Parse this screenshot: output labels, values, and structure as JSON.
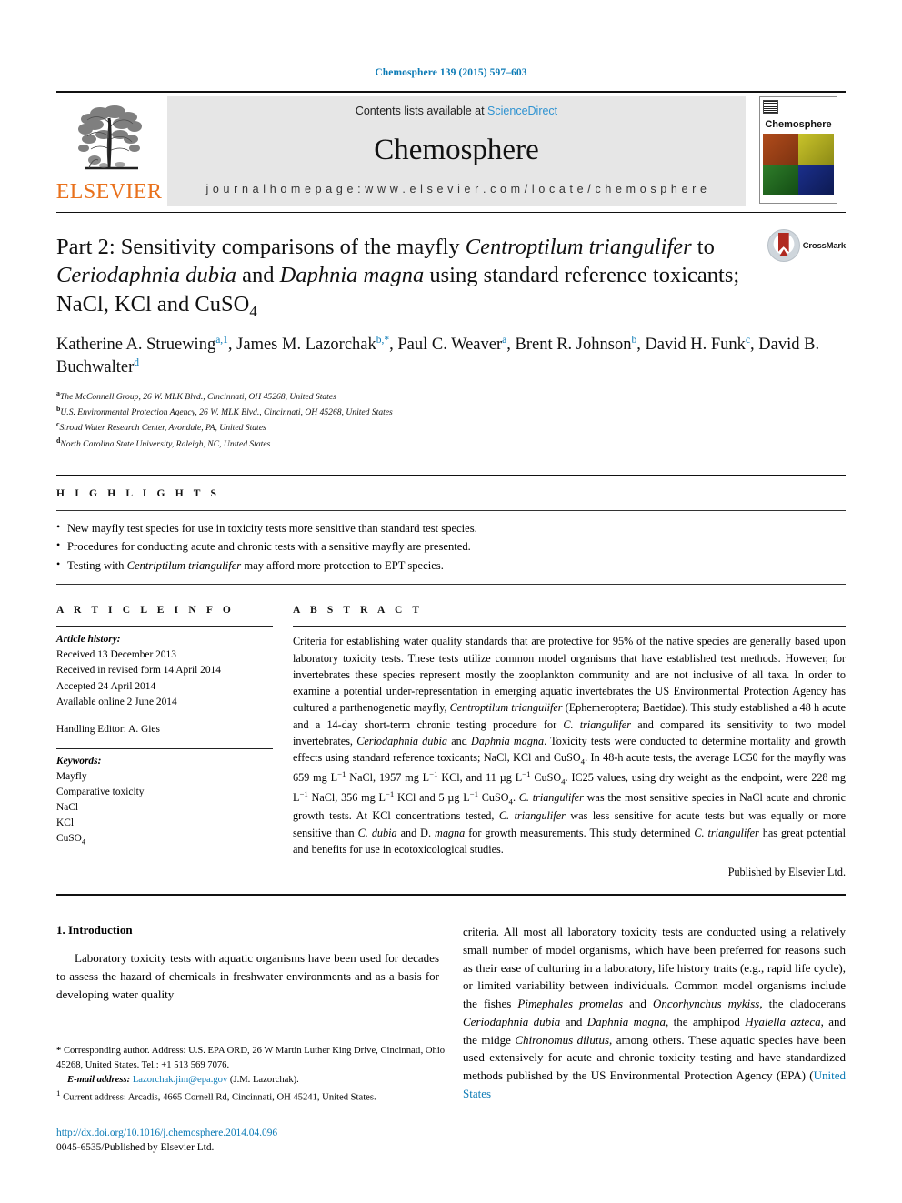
{
  "running_head": "Chemosphere 139 (2015) 597–603",
  "masthead": {
    "publisher_name": "ELSEVIER",
    "contents_text": "Contents lists available at ",
    "sciencedirect_label": "ScienceDirect",
    "journal_title": "Chemosphere",
    "homepage_text": "j o u r n a l   h o m e p a g e :   w w w . e l s e v i e r . c o m / l o c a t e / c h e m o s p h e r e",
    "cover_title": "Chemosphere",
    "accent_link_color": "#2f93d1",
    "elsevier_orange": "#E9711C"
  },
  "title": {
    "line1_a": "Part 2: Sensitivity comparisons of the mayfly ",
    "line1_i": "Centroptilum triangulifer",
    "line2_a": "to ",
    "line2_i1": "Ceriodaphnia dubia",
    "line2_b": " and ",
    "line2_i2": "Daphnia magna",
    "line2_c": " using standard reference",
    "line3_a": "toxicants; NaCl, KCl and CuSO",
    "line3_sub": "4",
    "crossmark_label": "CrossMark"
  },
  "authors": {
    "list": "Katherine A. Struewing a,1, James M. Lazorchak b,*, Paul C. Weaver a, Brent R. Johnson b, David H. Funk c, David B. Buchwalter d",
    "names": [
      {
        "name": "Katherine A. Struewing",
        "sup": "a,1"
      },
      {
        "name": "James M. Lazorchak",
        "sup": "b,*"
      },
      {
        "name": "Paul C. Weaver",
        "sup": "a"
      },
      {
        "name": "Brent R. Johnson",
        "sup": "b"
      },
      {
        "name": "David H. Funk",
        "sup": "c"
      },
      {
        "name": "David B. Buchwalter",
        "sup": "d"
      }
    ],
    "affiliations": [
      {
        "mark": "a",
        "text": "The McConnell Group, 26 W. MLK Blvd., Cincinnati, OH 45268, United States"
      },
      {
        "mark": "b",
        "text": "U.S. Environmental Protection Agency, 26 W. MLK Blvd., Cincinnati, OH 45268, United States"
      },
      {
        "mark": "c",
        "text": "Stroud Water Research Center, Avondale, PA, United States"
      },
      {
        "mark": "d",
        "text": "North Carolina State University, Raleigh, NC, United States"
      }
    ]
  },
  "highlights": {
    "heading": "H I G H L I G H T S",
    "items": [
      {
        "pre": "New mayfly test species for use in toxicity tests more sensitive than standard test species.",
        "italic": "",
        "post": ""
      },
      {
        "pre": "Procedures for conducting acute and chronic tests with a sensitive mayfly are presented.",
        "italic": "",
        "post": ""
      },
      {
        "pre": "Testing with ",
        "italic": "Centriptilum triangulifer",
        "post": " may afford more protection to EPT species."
      }
    ]
  },
  "article_info": {
    "heading": "A R T I C L E   I N F O",
    "history_label": "Article history:",
    "history": [
      "Received 13 December 2013",
      "Received in revised form 14 April 2014",
      "Accepted 24 April 2014",
      "Available online 2 June 2014"
    ],
    "handling_editor": "Handling Editor: A. Gies",
    "keywords_label": "Keywords:",
    "keywords": [
      "Mayfly",
      "Comparative toxicity",
      "NaCl",
      "KCl",
      "CuSO4"
    ]
  },
  "abstract": {
    "heading": "A B S T R A C T",
    "p1_a": "Criteria for establishing water quality standards that are protective for 95% of the native species are generally based upon laboratory toxicity tests. These tests utilize common model organisms that have established test methods. However, for invertebrates these species represent mostly the zooplankton community and are not inclusive of all taxa. In order to examine a potential under-representation in emerging aquatic invertebrates the US Environmental Protection Agency has cultured a parthenogenetic mayfly, ",
    "p1_i1": "Centroptilum triangulifer",
    "p1_b": " (Ephemeroptera; Baetidae). This study established a 48 h acute and a 14-day short-term chronic testing procedure for ",
    "p1_i2": "C. triangulifer",
    "p1_c": " and compared its sensitivity to two model invertebrates, ",
    "p1_i3": "Ceriodaphnia dubia",
    "p1_d": " and ",
    "p1_i4": "Daphnia magna",
    "p1_e": ". Toxicity tests were conducted to determine mortality and growth effects using standard reference toxicants; NaCl, KCl and CuSO",
    "p1_sub1": "4",
    "p1_f": ". In 48-h acute tests, the average LC50 for the mayfly was 659 mg L",
    "p1_sup1": "−1",
    "p1_g": " NaCl, 1957 mg L",
    "p1_sup2": "−1",
    "p1_h": " KCl, and 11 µg L",
    "p1_sup3": "−1",
    "p1_i": " CuSO",
    "p1_sub2": "4",
    "p1_j": ". IC25 values, using dry weight as the endpoint, were 228 mg L",
    "p1_sup4": "−1",
    "p1_k": " NaCl, 356 mg L",
    "p1_sup5": "−1",
    "p1_l": " KCl and 5 µg L",
    "p1_sup6": "−1",
    "p1_m": " CuSO",
    "p1_sub3": "4",
    "p1_n": ". ",
    "p1_i5": "C. triangulifer",
    "p1_o": " was the most sensitive species in NaCl acute and chronic growth tests. At KCl concentrations tested, ",
    "p1_i6": "C. triangulifer",
    "p1_p": " was less sensitive for acute tests but was equally or more sensitive than ",
    "p1_i7": "C. dubia",
    "p1_q": " and D. ",
    "p1_i8": "magna",
    "p1_r": " for growth measurements. This study determined ",
    "p1_i9": "C. triangulifer",
    "p1_s": " has great potential and benefits for use in ecotoxicological studies.",
    "published_by": "Published by Elsevier Ltd."
  },
  "introduction": {
    "heading": "1. Introduction",
    "left_p1": "Laboratory toxicity tests with aquatic organisms have been used for decades to assess the hazard of chemicals in freshwater environments and as a basis for developing water quality",
    "right_a": "criteria. All most all laboratory toxicity tests are conducted using a relatively small number of model organisms, which have been preferred for reasons such as their ease of culturing in a laboratory, life history traits (e.g., rapid life cycle), or limited variability between individuals. Common model organisms include the fishes ",
    "right_i1": "Pimephales promelas",
    "right_b": " and ",
    "right_i2": "Oncorhynchus mykiss",
    "right_c": ", the cladocerans ",
    "right_i3": "Ceriodaphnia dubia",
    "right_d": " and ",
    "right_i4": "Daphnia magna",
    "right_e": ", the amphipod ",
    "right_i5": "Hyalella azteca",
    "right_f": ", and the midge ",
    "right_i6": "Chironomus dilutus",
    "right_g": ", among others. These aquatic species have been used extensively for acute and chronic toxicity testing and have standardized methods published by the US Environmental Protection Agency (EPA) (",
    "right_cite": "United States"
  },
  "footnotes": {
    "corresponding_star": "*",
    "corresponding_text": " Corresponding author. Address: U.S. EPA ORD, 26 W Martin Luther King Drive, Cincinnati, Ohio 45268, United States. Tel.: +1 513 569 7076.",
    "email_label": "E-mail address:",
    "email_value": "Lazorchak.jim@epa.gov",
    "email_suffix": " (J.M. Lazorchak).",
    "current_mark": "1",
    "current_text": " Current address: Arcadis, 4665 Cornell Rd, Cincinnati, OH 45241, United States.",
    "doi": "http://dx.doi.org/10.1016/j.chemosphere.2014.04.096",
    "issn_line": "0045-6535/Published by Elsevier Ltd."
  }
}
